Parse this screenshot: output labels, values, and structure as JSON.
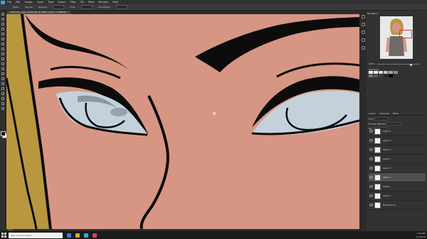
{
  "menu": {
    "items": [
      "File",
      "Edit",
      "Image",
      "Layer",
      "Type",
      "Select",
      "Filter",
      "3D",
      "View",
      "Window",
      "Help"
    ]
  },
  "options_bar": {
    "items": [
      "Mode:",
      "Normal",
      "Opacity:",
      "Flow:",
      "Smoothing:"
    ]
  },
  "document": {
    "tab_title": "character_eyes_detail.psd @ 200% (Layer 1, RGB/8) *",
    "zoom_status": "200%"
  },
  "panels": {
    "navigator_title": "Navigator",
    "zoom_value": "200%",
    "swatches_title": "Swatches",
    "swatch_colors": [
      "#ffffff",
      "#f2f2f2",
      "#d9d9d9",
      "#bfbfbf",
      "#a6a6a6",
      "#8c8c8c",
      "#737373",
      "#595959",
      "#404040",
      "#262626",
      "#000000"
    ],
    "layers": {
      "tabs": [
        "Layers",
        "Channels",
        "Paths"
      ],
      "kind_label": "Kind",
      "blend_mode": "Normal",
      "opacity_label": "Opacity:",
      "fill_label": "Fill:",
      "items": [
        {
          "name": "Layer 5",
          "selected": false
        },
        {
          "name": "Layer 4",
          "selected": false
        },
        {
          "name": "Layer 3",
          "selected": false
        },
        {
          "name": "Layer 2",
          "selected": false
        },
        {
          "name": "Layer 6",
          "selected": false
        },
        {
          "name": "Layer 1",
          "selected": true
        },
        {
          "name": "Sketch",
          "selected": false
        },
        {
          "name": "Layer 0",
          "selected": false
        },
        {
          "name": "Background",
          "selected": false
        }
      ]
    }
  },
  "taskbar": {
    "search_placeholder": "Type here to search",
    "time": "1:00 PM",
    "date": "1/1/2019"
  },
  "colors": {
    "skin": "#d79683",
    "hair": "#b8973f",
    "eye_white": "#c5d1da",
    "eye_shadow": "#8b969f",
    "ink": "#0c0c0c",
    "accent": "#31a8ff"
  }
}
